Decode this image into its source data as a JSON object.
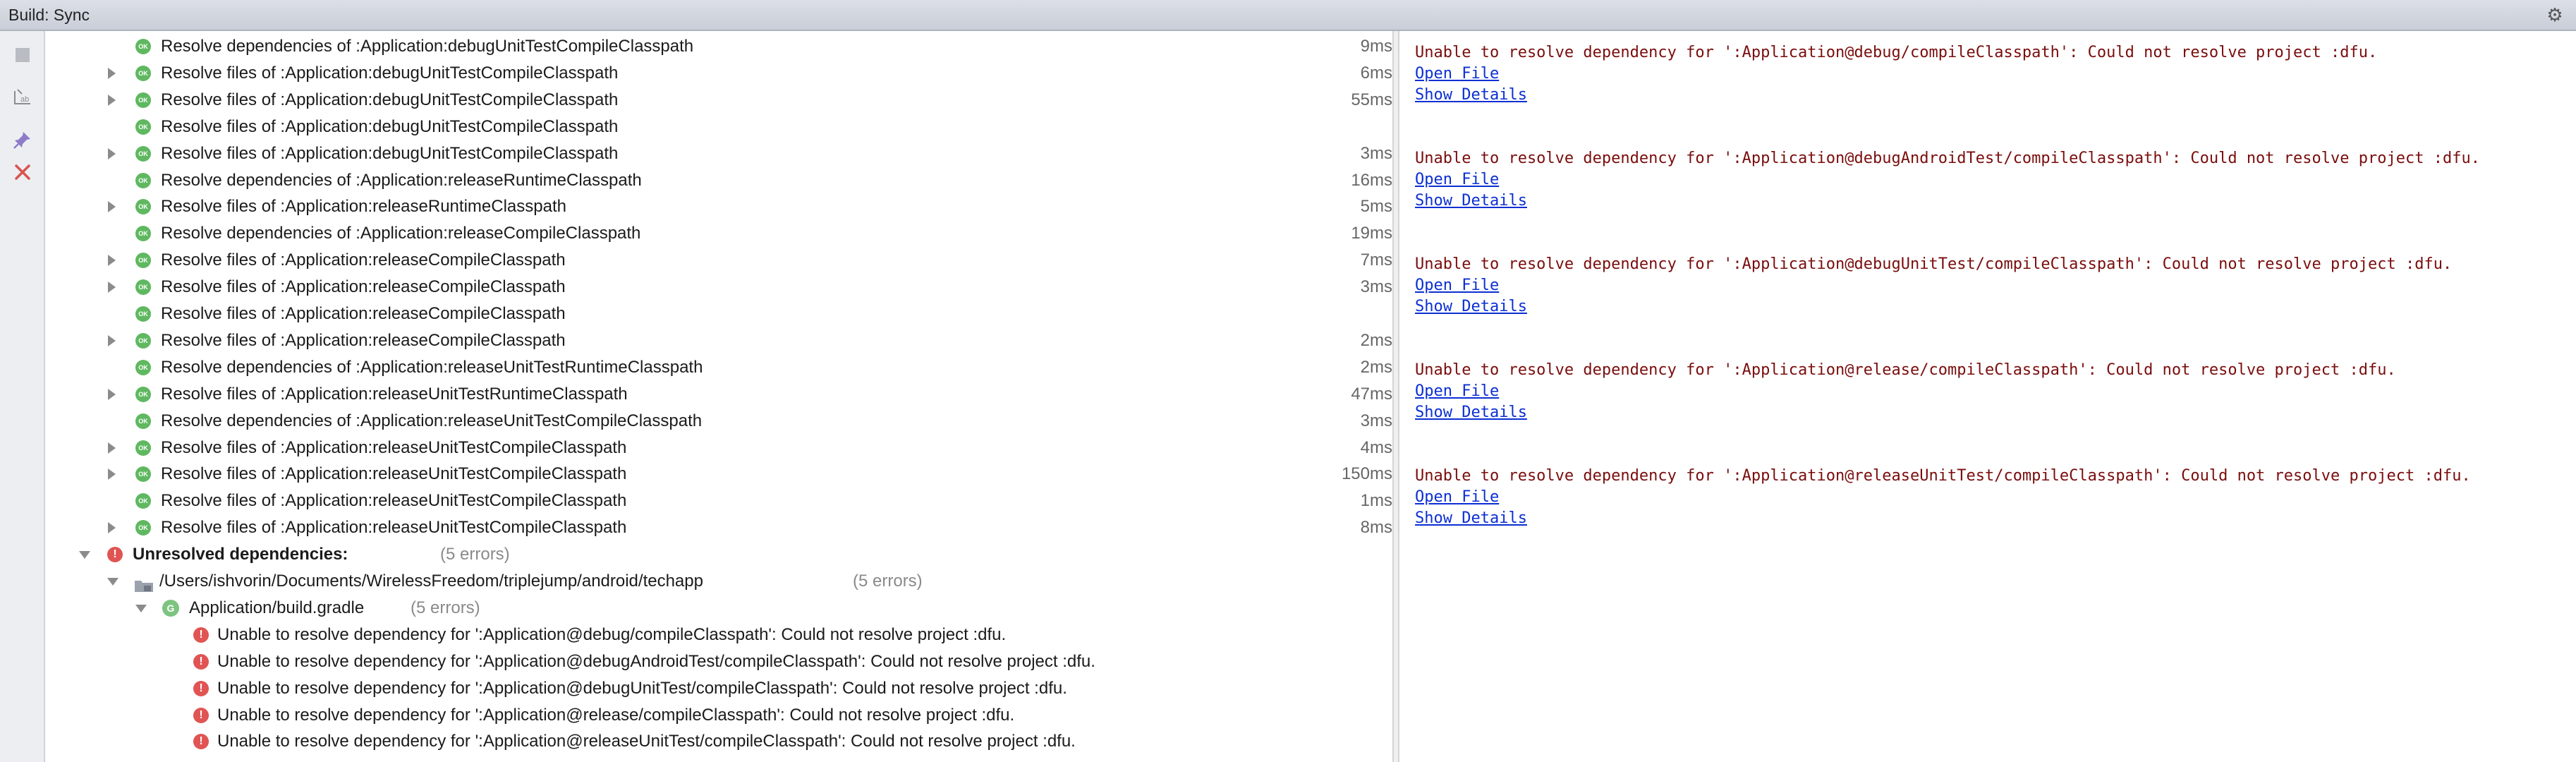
{
  "window": {
    "title": "Build: Sync",
    "settings_glyph": "⚙"
  },
  "toolbar": {
    "tools": [
      "stop-icon",
      "rerun-filter-icon",
      "pin-icon",
      "close-icon"
    ]
  },
  "tree": {
    "rows": [
      {
        "arrow": false,
        "text": "Resolve dependencies of :Application:debugUnitTestCompileClasspath",
        "time": "9ms"
      },
      {
        "arrow": true,
        "text": "Resolve files of :Application:debugUnitTestCompileClasspath",
        "time": "6ms"
      },
      {
        "arrow": true,
        "text": "Resolve files of :Application:debugUnitTestCompileClasspath",
        "time": "55ms"
      },
      {
        "arrow": false,
        "text": "Resolve files of :Application:debugUnitTestCompileClasspath",
        "time": ""
      },
      {
        "arrow": true,
        "text": "Resolve files of :Application:debugUnitTestCompileClasspath",
        "time": "3ms"
      },
      {
        "arrow": false,
        "text": "Resolve dependencies of :Application:releaseRuntimeClasspath",
        "time": "16ms"
      },
      {
        "arrow": true,
        "text": "Resolve files of :Application:releaseRuntimeClasspath",
        "time": "5ms"
      },
      {
        "arrow": false,
        "text": "Resolve dependencies of :Application:releaseCompileClasspath",
        "time": "19ms"
      },
      {
        "arrow": true,
        "text": "Resolve files of :Application:releaseCompileClasspath",
        "time": "7ms"
      },
      {
        "arrow": true,
        "text": "Resolve files of :Application:releaseCompileClasspath",
        "time": "3ms"
      },
      {
        "arrow": false,
        "text": "Resolve files of :Application:releaseCompileClasspath",
        "time": ""
      },
      {
        "arrow": true,
        "text": "Resolve files of :Application:releaseCompileClasspath",
        "time": "2ms"
      },
      {
        "arrow": false,
        "text": "Resolve dependencies of :Application:releaseUnitTestRuntimeClasspath",
        "time": "2ms"
      },
      {
        "arrow": true,
        "text": "Resolve files of :Application:releaseUnitTestRuntimeClasspath",
        "time": "47ms"
      },
      {
        "arrow": false,
        "text": "Resolve dependencies of :Application:releaseUnitTestCompileClasspath",
        "time": "3ms"
      },
      {
        "arrow": true,
        "text": "Resolve files of :Application:releaseUnitTestCompileClasspath",
        "time": "4ms"
      },
      {
        "arrow": true,
        "text": "Resolve files of :Application:releaseUnitTestCompileClasspath",
        "time": "150ms"
      },
      {
        "arrow": false,
        "text": "Resolve files of :Application:releaseUnitTestCompileClasspath",
        "time": "1ms"
      },
      {
        "arrow": true,
        "text": "Resolve files of :Application:releaseUnitTestCompileClasspath",
        "time": "8ms"
      }
    ],
    "unresolved": {
      "label": "Unresolved dependencies:",
      "count": "(5 errors)"
    },
    "project": {
      "path": "/Users/ishvorin/Documents/WirelessFreedom/triplejump/android/techapp",
      "count": "(5 errors)"
    },
    "gradle_file": {
      "name": "Application/build.gradle",
      "count": "(5 errors)",
      "badge": "G"
    },
    "errors": [
      "Unable to resolve dependency for ':Application@debug/compileClasspath': Could not resolve project :dfu.",
      "Unable to resolve dependency for ':Application@debugAndroidTest/compileClasspath': Could not resolve project :dfu.",
      "Unable to resolve dependency for ':Application@debugUnitTest/compileClasspath': Could not resolve project :dfu.",
      "Unable to resolve dependency for ':Application@release/compileClasspath': Could not resolve project :dfu.",
      "Unable to resolve dependency for ':Application@releaseUnitTest/compileClasspath': Could not resolve project :dfu."
    ],
    "ok_badge": "OK",
    "err_badge": "!"
  },
  "console": {
    "messages": [
      {
        "text": "Unable to resolve dependency for ':Application@debug/compileClasspath': Could not resolve project :dfu.",
        "open_file": "Open File",
        "show_details": "Show Details"
      },
      {
        "text": "Unable to resolve dependency for ':Application@debugAndroidTest/compileClasspath': Could not resolve project :dfu.",
        "open_file": "Open File",
        "show_details": "Show Details"
      },
      {
        "text": "Unable to resolve dependency for ':Application@debugUnitTest/compileClasspath': Could not resolve project :dfu.",
        "open_file": "Open File",
        "show_details": "Show Details"
      },
      {
        "text": "Unable to resolve dependency for ':Application@release/compileClasspath': Could not resolve project :dfu.",
        "open_file": "Open File",
        "show_details": "Show Details"
      },
      {
        "text": "Unable to resolve dependency for ':Application@releaseUnitTest/compileClasspath': Could not resolve project :dfu.",
        "open_file": "Open File",
        "show_details": "Show Details"
      }
    ]
  },
  "colors": {
    "ok": "#5fb860",
    "error": "#e05453",
    "console_error": "#7a0d0d",
    "link": "#0b2fd3"
  }
}
